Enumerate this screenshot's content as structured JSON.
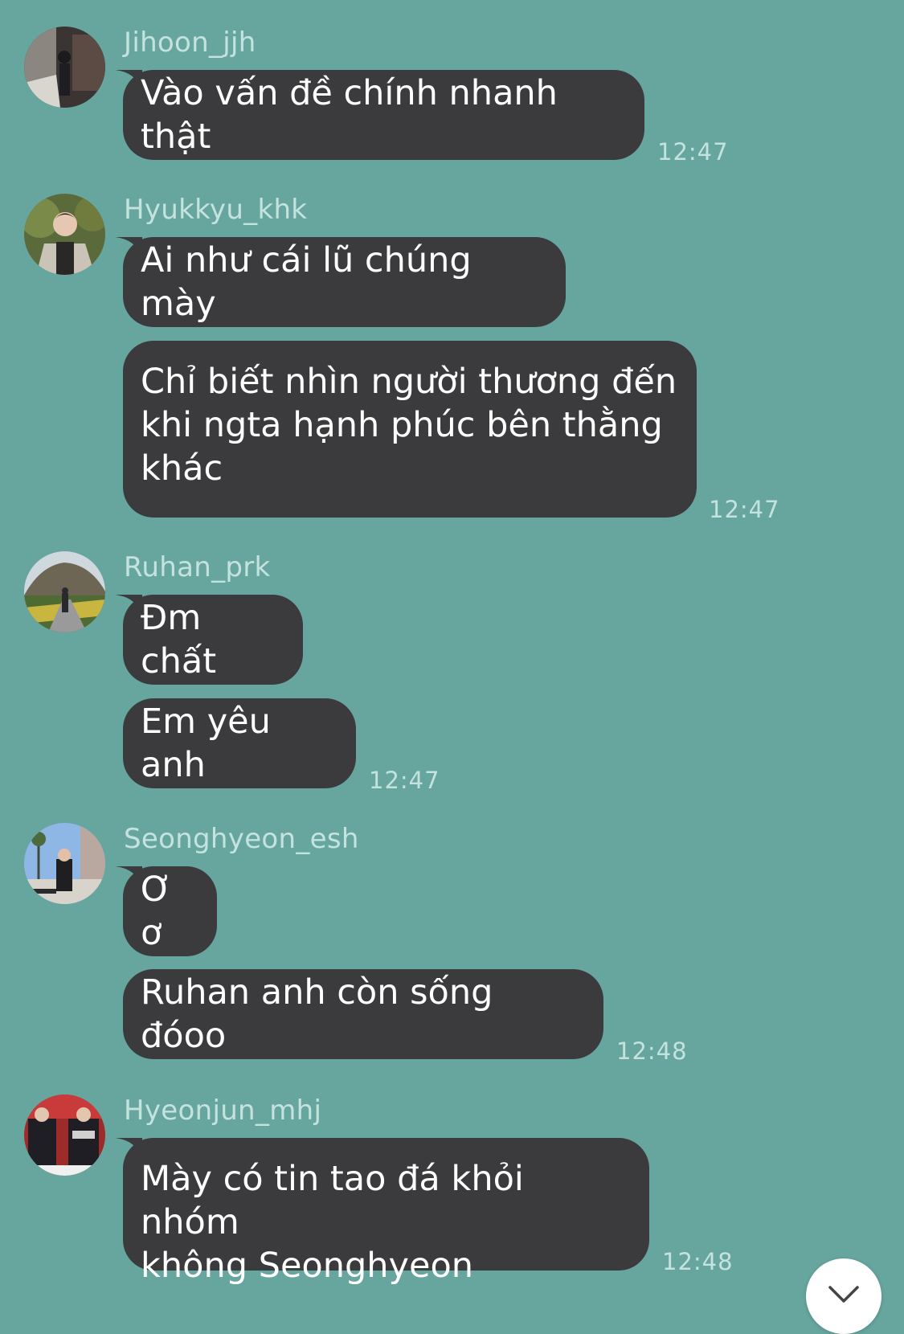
{
  "theme": {
    "background": "#67a59f",
    "bubble": "#3b3b3d",
    "bubble_text": "#ffffff",
    "meta_text": "#c4e3df"
  },
  "messages": [
    {
      "sender": "Jihoon_jjh",
      "bubbles": [
        "Vào vấn đề chính nhanh thật"
      ],
      "time": "12:47"
    },
    {
      "sender": "Hyukkyu_khk",
      "bubbles": [
        "Ai như cái lũ chúng mày",
        "Chỉ biết nhìn người thương đến\nkhi ngta hạnh phúc bên thằng\nkhác"
      ],
      "time": "12:47"
    },
    {
      "sender": "Ruhan_prk",
      "bubbles": [
        "Đm chất",
        "Em yêu anh"
      ],
      "time": "12:47"
    },
    {
      "sender": "Seonghyeon_esh",
      "bubbles": [
        "Ơ ơ",
        "Ruhan anh còn sống đóoo"
      ],
      "time": "12:48"
    },
    {
      "sender": "Hyeonjun_mhj",
      "bubbles": [
        "Mày có tin tao đá khỏi nhóm\nkhông Seonghyeon"
      ],
      "time": "12:48"
    }
  ],
  "scroll_button_icon": "chevron-down-icon"
}
